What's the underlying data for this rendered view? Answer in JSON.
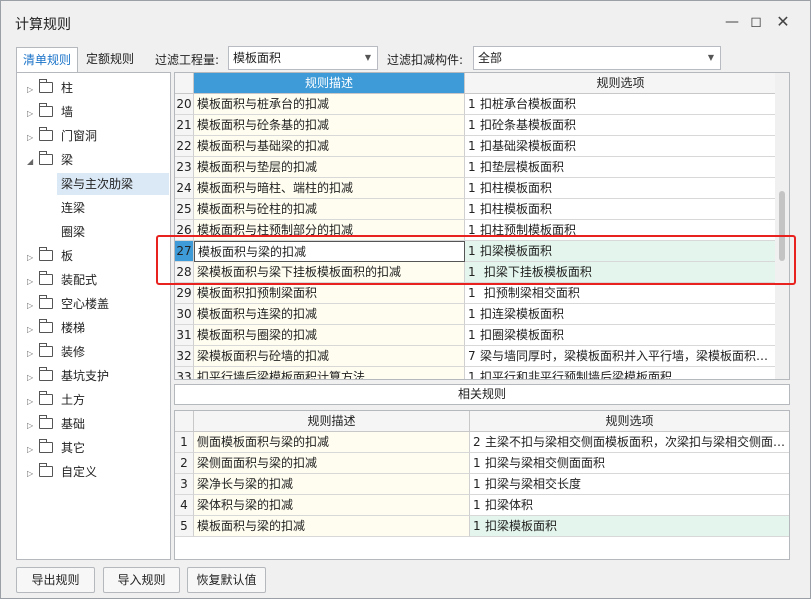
{
  "window": {
    "title": "计算规则"
  },
  "tabs": [
    {
      "label": "清单规则"
    },
    {
      "label": "定额规则"
    }
  ],
  "filters": {
    "quantity_label": "过滤工程量:",
    "quantity_value": "模板面积",
    "component_label": "过滤扣减构件:",
    "component_value": "全部"
  },
  "tree": [
    {
      "label": "柱",
      "expanded": false
    },
    {
      "label": "墙",
      "expanded": false
    },
    {
      "label": "门窗洞",
      "expanded": false
    },
    {
      "label": "梁",
      "expanded": true
    },
    {
      "label": "梁与主次肋梁",
      "child": true,
      "selected": true
    },
    {
      "label": "连梁",
      "child": true
    },
    {
      "label": "圈梁",
      "child": true
    },
    {
      "label": "板",
      "expanded": false
    },
    {
      "label": "装配式",
      "expanded": false
    },
    {
      "label": "空心楼盖",
      "expanded": false
    },
    {
      "label": "楼梯",
      "expanded": false
    },
    {
      "label": "装修",
      "expanded": false
    },
    {
      "label": "基坑支护",
      "expanded": false
    },
    {
      "label": "土方",
      "expanded": false
    },
    {
      "label": "基础",
      "expanded": false
    },
    {
      "label": "其它",
      "expanded": false
    },
    {
      "label": "自定义",
      "expanded": false
    }
  ],
  "main_table": {
    "headers": {
      "desc": "规则描述",
      "option": "规则选项"
    },
    "rows": [
      {
        "num": "20",
        "desc": "模板面积与桩承台的扣减",
        "opt_num": "1",
        "opt": "扣桩承台模板面积"
      },
      {
        "num": "21",
        "desc": "模板面积与砼条基的扣减",
        "opt_num": "1",
        "opt": "扣砼条基模板面积"
      },
      {
        "num": "22",
        "desc": "模板面积与基础梁的扣减",
        "opt_num": "1",
        "opt": "扣基础梁模板面积"
      },
      {
        "num": "23",
        "desc": "模板面积与垫层的扣减",
        "opt_num": "1",
        "opt": "扣垫层模板面积"
      },
      {
        "num": "24",
        "desc": "模板面积与暗柱、端柱的扣减",
        "opt_num": "1",
        "opt": "扣柱模板面积"
      },
      {
        "num": "25",
        "desc": "模板面积与砼柱的扣减",
        "opt_num": "1",
        "opt": "扣柱模板面积"
      },
      {
        "num": "26",
        "desc": "模板面积与柱预制部分的扣减",
        "opt_num": "1",
        "opt": "扣柱预制模板面积"
      },
      {
        "num": "27",
        "desc": "模板面积与梁的扣减",
        "opt_num": "1",
        "opt": "扣梁模板面积"
      },
      {
        "num": "28",
        "desc": "梁模板面积与梁下挂板模板面积的扣减",
        "opt_num": "1",
        "opt": " 扣梁下挂板模板面积"
      },
      {
        "num": "29",
        "desc": "模板面积扣预制梁面积",
        "opt_num": "1",
        "opt": " 扣预制梁相交面积"
      },
      {
        "num": "30",
        "desc": "模板面积与连梁的扣减",
        "opt_num": "1",
        "opt": "扣连梁模板面积"
      },
      {
        "num": "31",
        "desc": "模板面积与圈梁的扣减",
        "opt_num": "1",
        "opt": "扣圈梁模板面积"
      },
      {
        "num": "32",
        "desc": "梁模板面积与砼墙的扣减",
        "opt_num": "7",
        "opt": "梁与墙同厚时，梁模板面积并入平行墙，梁模板面积…"
      },
      {
        "num": "33",
        "desc": "扣平行墙后梁模板面积计算方法",
        "opt_num": "1",
        "opt": "扣平行和非平行预制墙后梁模板面积"
      }
    ]
  },
  "related": {
    "label": "相关规则"
  },
  "related_table": {
    "headers": {
      "desc": "规则描述",
      "option": "规则选项"
    },
    "rows": [
      {
        "num": "1",
        "desc": "侧面模板面积与梁的扣减",
        "opt_num": "2",
        "opt": "主梁不扣与梁相交侧面模板面积，次梁扣与梁相交侧面…"
      },
      {
        "num": "2",
        "desc": "梁侧面面积与梁的扣减",
        "opt_num": "1",
        "opt": "扣梁与梁相交侧面面积"
      },
      {
        "num": "3",
        "desc": "梁净长与梁的扣减",
        "opt_num": "1",
        "opt": "扣梁与梁相交长度"
      },
      {
        "num": "4",
        "desc": "梁体积与梁的扣减",
        "opt_num": "1",
        "opt": "扣梁体积"
      },
      {
        "num": "5",
        "desc": "模板面积与梁的扣减",
        "opt_num": "1",
        "opt": "扣梁模板面积"
      }
    ]
  },
  "buttons": {
    "export": "导出规则",
    "import": "导入规则",
    "restore": "恢复默认值"
  }
}
